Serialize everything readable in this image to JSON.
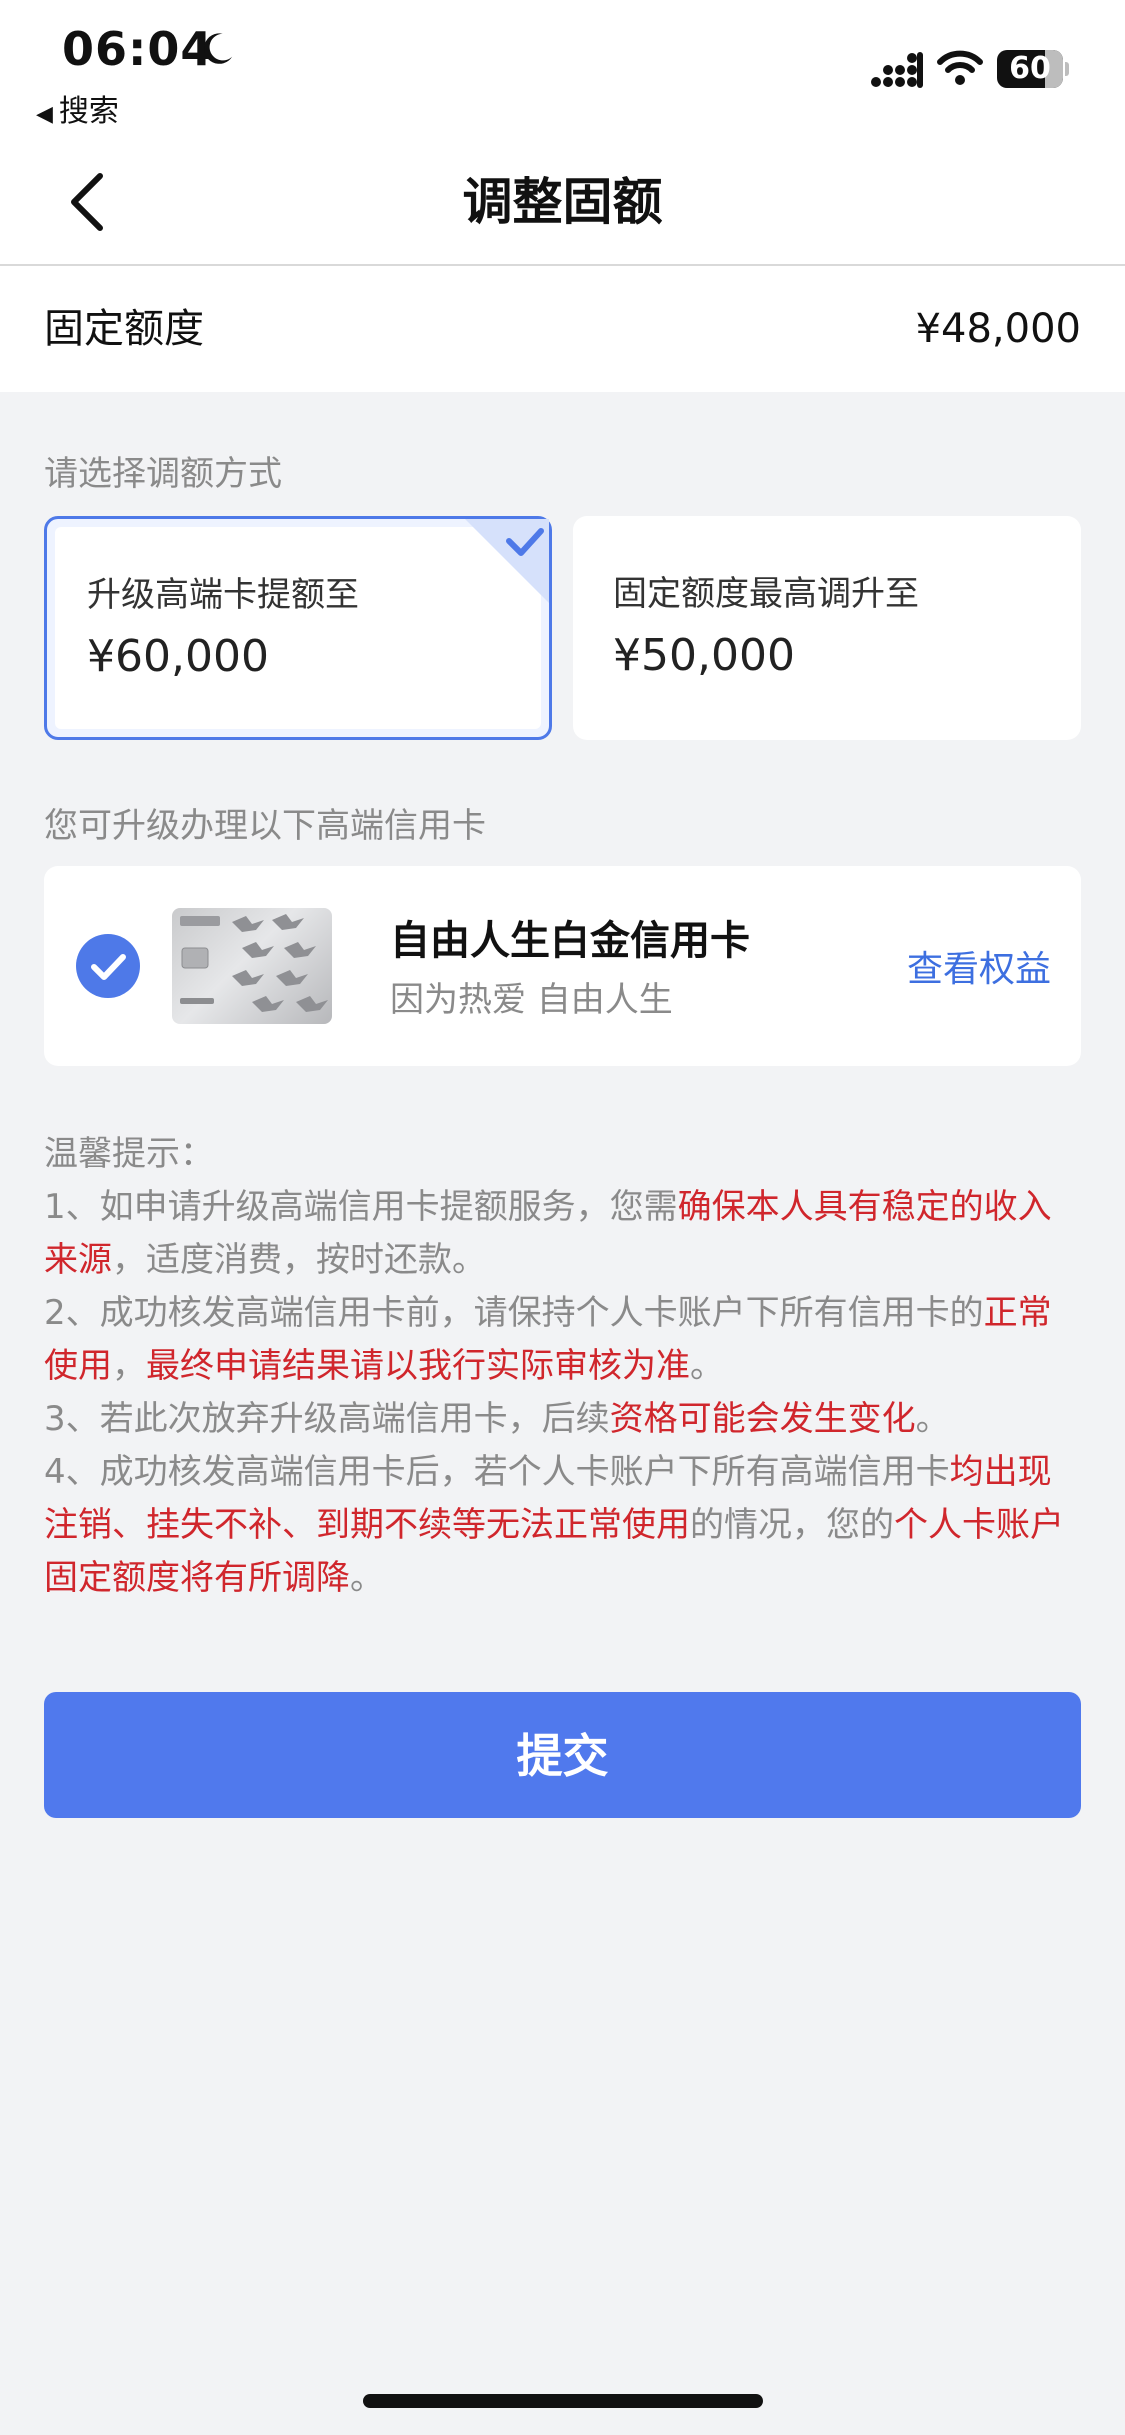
{
  "status_bar": {
    "time": "06:04",
    "back_app": "搜索",
    "battery": "60"
  },
  "nav": {
    "title": "调整固额"
  },
  "quota": {
    "label": "固定额度",
    "value": "¥48,000"
  },
  "choose_label": "请选择调额方式",
  "options": [
    {
      "title": "升级高端卡提额至",
      "amount": "¥60,000",
      "selected": true
    },
    {
      "title": "固定额度最高调升至",
      "amount": "¥50,000",
      "selected": false
    }
  ],
  "upgrade_label": "您可升级办理以下高端信用卡",
  "card": {
    "name": "自由人生白金信用卡",
    "slogan": "因为热爱 自由人生",
    "link": "查看权益"
  },
  "tips": {
    "heading": "温馨提示：",
    "t1_a": "1、如申请升级高端信用卡提额服务，您需",
    "t1_b": "确保本人具有稳定的收入来源",
    "t1_c": "，适度消费，按时还款。",
    "t2_a": "2、成功核发高端信用卡前，请保持个人卡账户下所有信用卡的",
    "t2_b": "正常使用",
    "t2_c": "，",
    "t2_d": "最终申请结果请以我行实际审核为准",
    "t2_e": "。",
    "t3_a": "3、若此次放弃升级高端信用卡，后续",
    "t3_b": "资格可能会发生变化",
    "t3_c": "。",
    "t4_a": "4、成功核发高端信用卡后，若个人卡账户下所有高端信用卡",
    "t4_b": "均出现注销、挂失不补、到期不续等无法正常使用",
    "t4_c": "的情况，您的",
    "t4_d": "个人卡账户固定额度将有所调降",
    "t4_e": "。"
  },
  "submit_label": "提交",
  "colors": {
    "accent": "#5079ed",
    "link": "#3d6fe0",
    "warning": "#d0262c",
    "background": "#f2f3f5"
  }
}
